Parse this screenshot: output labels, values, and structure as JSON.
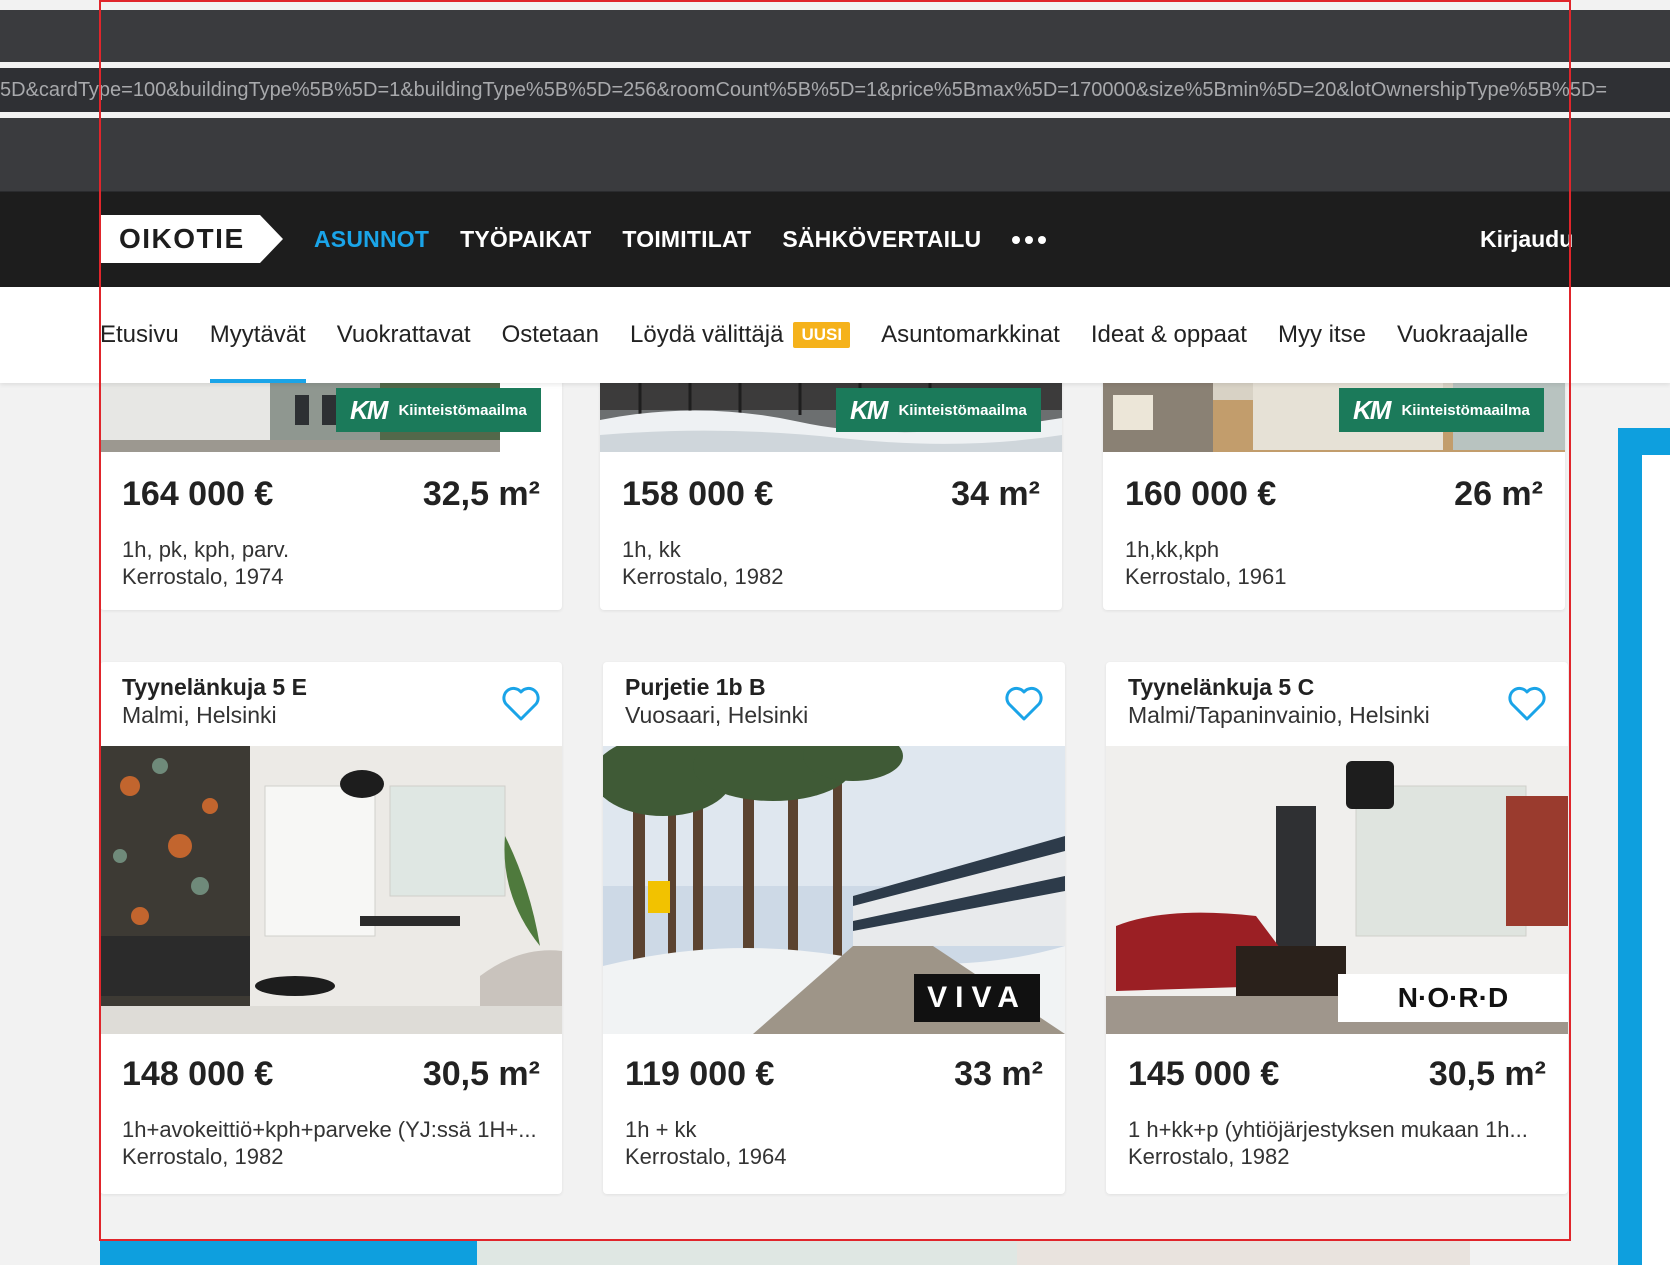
{
  "browser": {
    "address_text": "5D&cardType=100&buildingType%5B%5D=1&buildingType%5B%5D=256&roomCount%5B%5D=1&price%5Bmax%5D=170000&size%5Bmin%5D=20&lotOwnershipType%5B%5D="
  },
  "header": {
    "logo": "OIKOTIE",
    "nav": [
      "ASUNNOT",
      "TYÖPAIKAT",
      "TOIMITILAT",
      "SÄHKÖVERTAILU"
    ],
    "active_nav": "ASUNNOT",
    "more_icon": "ellipsis-icon",
    "login": "Kirjaudu"
  },
  "subnav": {
    "items": [
      {
        "label": "Etusivu"
      },
      {
        "label": "Myytävät"
      },
      {
        "label": "Vuokrattavat"
      },
      {
        "label": "Ostetaan"
      },
      {
        "label": "Löydä välittäjä",
        "badge": "UUSI"
      },
      {
        "label": "Asuntomarkkinat"
      },
      {
        "label": "Ideat & oppaat"
      },
      {
        "label": "Myy itse"
      },
      {
        "label": "Vuokraajalle"
      }
    ],
    "active": "Myytävät"
  },
  "colors": {
    "accent": "#1aa4e8",
    "header_bg": "#1d1d1d",
    "badge": "#f5b21b",
    "km_green": "#1b7a5a"
  },
  "listings_top": [
    {
      "price": "164 000 €",
      "size": "32,5 m²",
      "rooms": "1h, pk, kph, parv.",
      "type": "Kerrostalo, 1974",
      "agency": "Kiinteistömaailma",
      "agency_mark": "KM"
    },
    {
      "price": "158 000 €",
      "size": "34 m²",
      "rooms": "1h, kk",
      "type": "Kerrostalo, 1982",
      "agency": "Kiinteistömaailma",
      "agency_mark": "KM"
    },
    {
      "price": "160 000 €",
      "size": "26 m²",
      "rooms": "1h,kk,kph",
      "type": "Kerrostalo, 1961",
      "agency": "Kiinteistömaailma",
      "agency_mark": "KM"
    }
  ],
  "listings_bottom": [
    {
      "street": "Tyynelänkuja 5 E",
      "area": "Malmi, Helsinki",
      "price": "148 000 €",
      "size": "30,5 m²",
      "rooms": "1h+avokeittiö+kph+parveke (YJ:ssä 1H+...",
      "type": "Kerrostalo, 1982"
    },
    {
      "street": "Purjetie 1b B",
      "area": "Vuosaari, Helsinki",
      "price": "119 000 €",
      "size": "33 m²",
      "rooms": "1h + kk",
      "type": "Kerrostalo, 1964",
      "agency": "VIVA"
    },
    {
      "street": "Tyynelänkuja 5 C",
      "area": "Malmi/Tapaninvainio, Helsinki",
      "price": "145 000 €",
      "size": "30,5 m²",
      "rooms": "1 h+kk+p (yhtiöjärjestyksen mukaan 1h...",
      "type": "Kerrostalo, 1982",
      "agency": "N·O·R·D"
    }
  ]
}
